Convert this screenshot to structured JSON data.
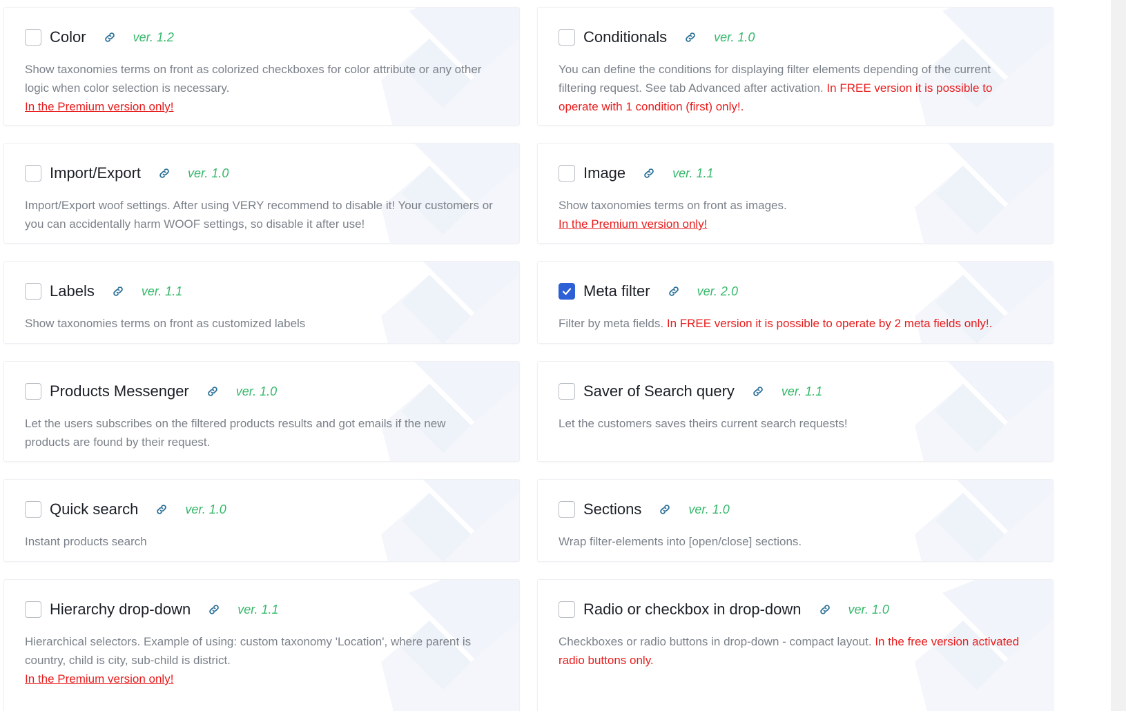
{
  "cards": [
    {
      "title": "Color",
      "ver": "ver. 1.2",
      "desc": "Show taxonomies terms on front as colorized checkboxes for color attribute or any other logic when color selection is necessary.",
      "premium": "In the Premium version only!",
      "checked": false
    },
    {
      "title": "Conditionals",
      "ver": "ver. 1.0",
      "desc": "You can define the conditions for displaying filter elements depending of the current filtering request. See tab Advanced after activation.",
      "note": "In FREE version it is possible to operate with 1 condition (first) only!.",
      "checked": false
    },
    {
      "title": "Import/Export",
      "ver": "ver. 1.0",
      "desc": "Import/Export woof settings. After using VERY recommend to disable it! Your customers or you can accidentally harm WOOF settings, so disable it after use!",
      "checked": false
    },
    {
      "title": "Image",
      "ver": "ver. 1.1",
      "desc": "Show taxonomies terms on front as images.",
      "premium": "In the Premium version only!",
      "checked": false
    },
    {
      "title": "Labels",
      "ver": "ver. 1.1",
      "desc": "Show taxonomies terms on front as customized labels",
      "checked": false
    },
    {
      "title": "Meta filter",
      "ver": "ver. 2.0",
      "desc": "Filter by meta fields.",
      "note": "In FREE version it is possible to operate by 2 meta fields only!.",
      "checked": true
    },
    {
      "title": "Products Messenger",
      "ver": "ver. 1.0",
      "desc": "Let the users subscribes on the filtered products results and got emails if the new products are found by their request.",
      "checked": false
    },
    {
      "title": "Saver of Search query",
      "ver": "ver. 1.1",
      "desc": "Let the customers saves theirs current search requests!",
      "checked": false
    },
    {
      "title": "Quick search",
      "ver": "ver. 1.0",
      "desc": "Instant products search",
      "checked": false
    },
    {
      "title": "Sections",
      "ver": "ver. 1.0",
      "desc": "Wrap filter-elements into [open/close] sections.",
      "checked": false
    },
    {
      "title": "Hierarchy drop-down",
      "ver": "ver. 1.1",
      "desc": "Hierarchical selectors. Example of using: custom taxonomy 'Location', where parent is country, child is city, sub-child is district.",
      "premium": "In the Premium version only!",
      "checked": false
    },
    {
      "title": "Radio or checkbox in drop-down",
      "ver": "ver. 1.0",
      "desc": "Checkboxes or radio buttons in drop-down - compact layout.",
      "note": "In the free version activated radio buttons only.",
      "checked": false
    }
  ],
  "colors": {
    "accent_checked": "#2d5fd6",
    "version_green": "#35b86a",
    "warning_red": "#e81b1b",
    "text_gray": "#7b8189"
  }
}
